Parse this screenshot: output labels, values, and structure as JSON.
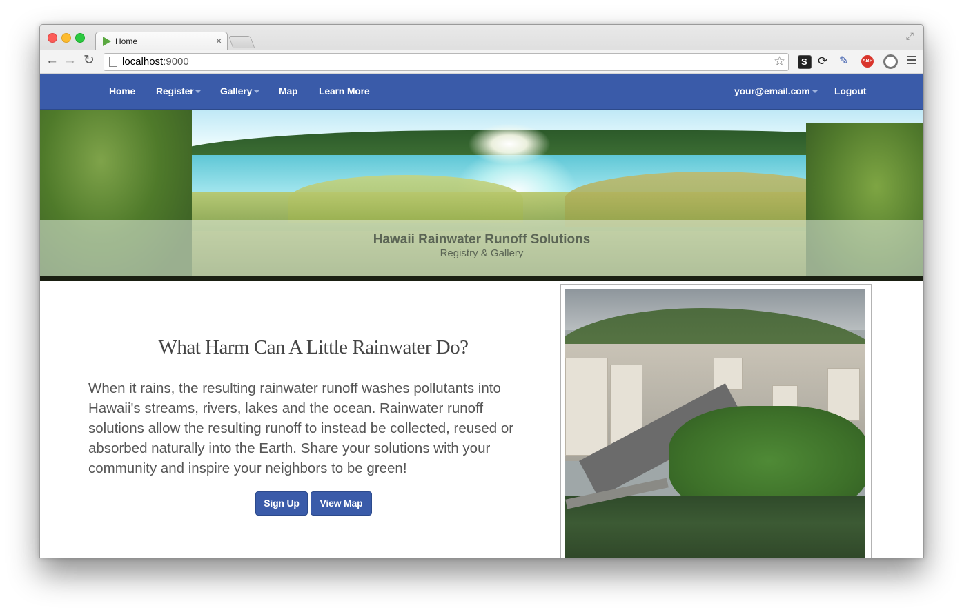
{
  "browser": {
    "tab_title": "Home",
    "tab_close": "×",
    "url_host": "localhost",
    "url_port": ":9000",
    "back_icon": "←",
    "forward_icon": "→",
    "reload_icon": "↻",
    "star_icon": "☆",
    "extensions": [
      "s-extension-icon",
      "sync-icon",
      "eyedropper-icon",
      "adblock-plus-icon",
      "circle-extension-icon"
    ],
    "abp_label": "ABP"
  },
  "navbar": {
    "color": "#3a5ba9",
    "items": [
      {
        "label": "Home",
        "dropdown": false
      },
      {
        "label": "Register",
        "dropdown": true
      },
      {
        "label": "Gallery",
        "dropdown": true
      },
      {
        "label": "Map",
        "dropdown": false
      },
      {
        "label": "Learn More",
        "dropdown": false
      }
    ],
    "user_email": "your@email.com",
    "logout": "Logout"
  },
  "hero": {
    "title": "Hawaii Rainwater Runoff Solutions",
    "subtitle": "Registry & Gallery"
  },
  "main": {
    "heading": "What Harm Can A Little Rainwater Do?",
    "paragraph": "When it rains, the resulting rainwater runoff washes pollutants into Hawaii's streams, rivers, lakes and the ocean. Rainwater runoff solutions allow the resulting runoff to instead be collected, reused or absorbed naturally into the Earth. Share your solutions with your community and inspire your neighbors to be green!",
    "signup_button": "Sign Up",
    "view_map_button": "View Map"
  }
}
